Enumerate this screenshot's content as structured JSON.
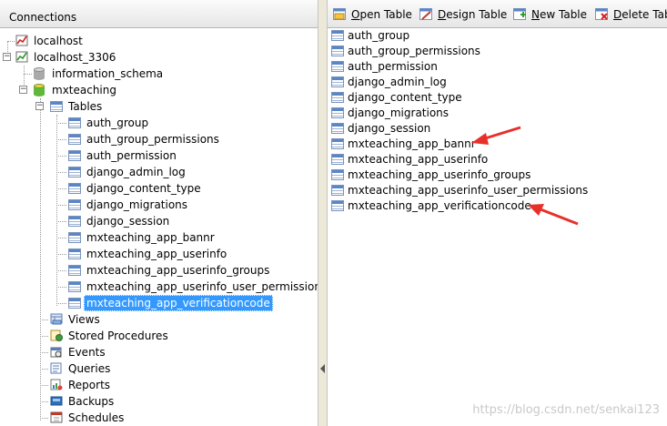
{
  "left_header": {
    "title": "Connections"
  },
  "tree": {
    "connections": [
      {
        "label": "localhost"
      },
      {
        "label": "localhost_3306"
      }
    ],
    "databases": [
      {
        "label": "information_schema"
      },
      {
        "label": "mxteaching"
      }
    ],
    "tables_label": "Tables",
    "tables": [
      "auth_group",
      "auth_group_permissions",
      "auth_permission",
      "django_admin_log",
      "django_content_type",
      "django_migrations",
      "django_session",
      "mxteaching_app_bannr",
      "mxteaching_app_userinfo",
      "mxteaching_app_userinfo_groups",
      "mxteaching_app_userinfo_user_permissions",
      "mxteaching_app_verificationcode"
    ],
    "selected_table": "mxteaching_app_verificationcode",
    "objects": [
      {
        "label": "Views",
        "icon": "views-icon"
      },
      {
        "label": "Stored Procedures",
        "icon": "stored-procedures-icon"
      },
      {
        "label": "Events",
        "icon": "events-icon"
      },
      {
        "label": "Queries",
        "icon": "queries-icon"
      },
      {
        "label": "Reports",
        "icon": "reports-icon"
      },
      {
        "label": "Backups",
        "icon": "backups-icon"
      },
      {
        "label": "Schedules",
        "icon": "schedules-icon"
      }
    ]
  },
  "toolbar": {
    "open_table": "Open Table",
    "design_table": "Design Table",
    "new_table": "New Table",
    "delete_table": "Delete Table"
  },
  "table_list": [
    "auth_group",
    "auth_group_permissions",
    "auth_permission",
    "django_admin_log",
    "django_content_type",
    "django_migrations",
    "django_session",
    "mxteaching_app_bannr",
    "mxteaching_app_userinfo",
    "mxteaching_app_userinfo_groups",
    "mxteaching_app_userinfo_user_permissions",
    "mxteaching_app_verificationcode"
  ],
  "watermark": "https://blog.csdn.net/senkai123",
  "colors": {
    "selection": "#3399ff",
    "annotation_arrow": "#e8302a"
  }
}
